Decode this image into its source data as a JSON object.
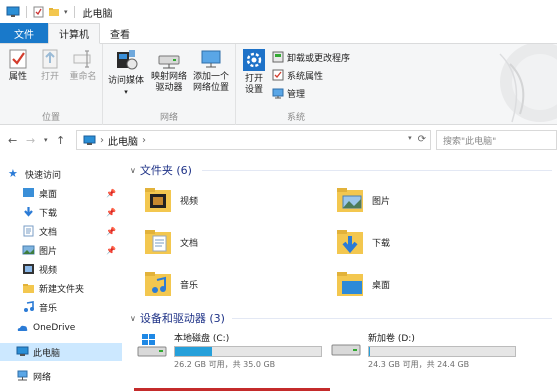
{
  "titlebar": {
    "title": "此电脑"
  },
  "tabs": [
    "文件",
    "计算机",
    "查看"
  ],
  "ribbon": {
    "location": {
      "label": "位置",
      "buttons": [
        "属性",
        "打开",
        "重命名"
      ]
    },
    "network": {
      "label": "网络",
      "buttons": [
        "访问媒体",
        "映射网络\n驱动器",
        "添加一个\n网络位置"
      ]
    },
    "system": {
      "label": "系统",
      "open_settings": "打开\n设置",
      "small": [
        "卸载或更改程序",
        "系统属性",
        "管理"
      ]
    }
  },
  "address": {
    "path": "此电脑",
    "search_placeholder": "搜索\"此电脑\""
  },
  "nav": {
    "quick_access": "快速访问",
    "items": [
      "桌面",
      "下载",
      "文档",
      "图片",
      "视频",
      "新建文件夹",
      "音乐"
    ],
    "onedrive": "OneDrive",
    "this_pc": "此电脑",
    "network": "网络"
  },
  "folders_section": {
    "title": "文件夹 (6)",
    "items": [
      "视频",
      "图片",
      "文档",
      "下载",
      "音乐",
      "桌面"
    ]
  },
  "drives_section": {
    "title": "设备和驱动器 (3)",
    "drives": [
      {
        "name": "本地磁盘 (C:)",
        "free": "26.2 GB 可用，共 35.0 GB",
        "used_fraction": 0.25
      },
      {
        "name": "新加卷 (D:)",
        "free": "24.3 GB 可用，共 24.4 GB",
        "used_fraction": 0.004
      }
    ]
  },
  "colors": {
    "accent": "#1979ca",
    "folder": "#f3c74f",
    "selected": "#cce8ff",
    "drive_fill": "#26a0da"
  }
}
